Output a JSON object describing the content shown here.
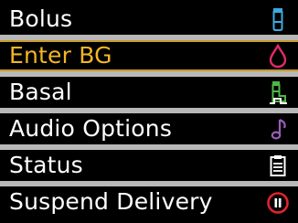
{
  "menu": {
    "items": [
      {
        "label": "Bolus",
        "icon": "bolus-vial-icon",
        "color": "#3fa9e0"
      },
      {
        "label": "Enter BG",
        "icon": "blood-drop-icon",
        "color": "#e0296a",
        "selected": true
      },
      {
        "label": "Basal",
        "icon": "basal-bottle-icon",
        "color": "#4fb548"
      },
      {
        "label": "Audio Options",
        "icon": "music-note-icon",
        "color": "#9b5db8"
      },
      {
        "label": "Status",
        "icon": "clipboard-icon",
        "color": "#ffffff"
      },
      {
        "label": "Suspend Delivery",
        "icon": "pause-circle-icon",
        "color": "#e0232e"
      }
    ],
    "selected_color": "#f2b623",
    "separator_color": "#b8b8b8"
  }
}
